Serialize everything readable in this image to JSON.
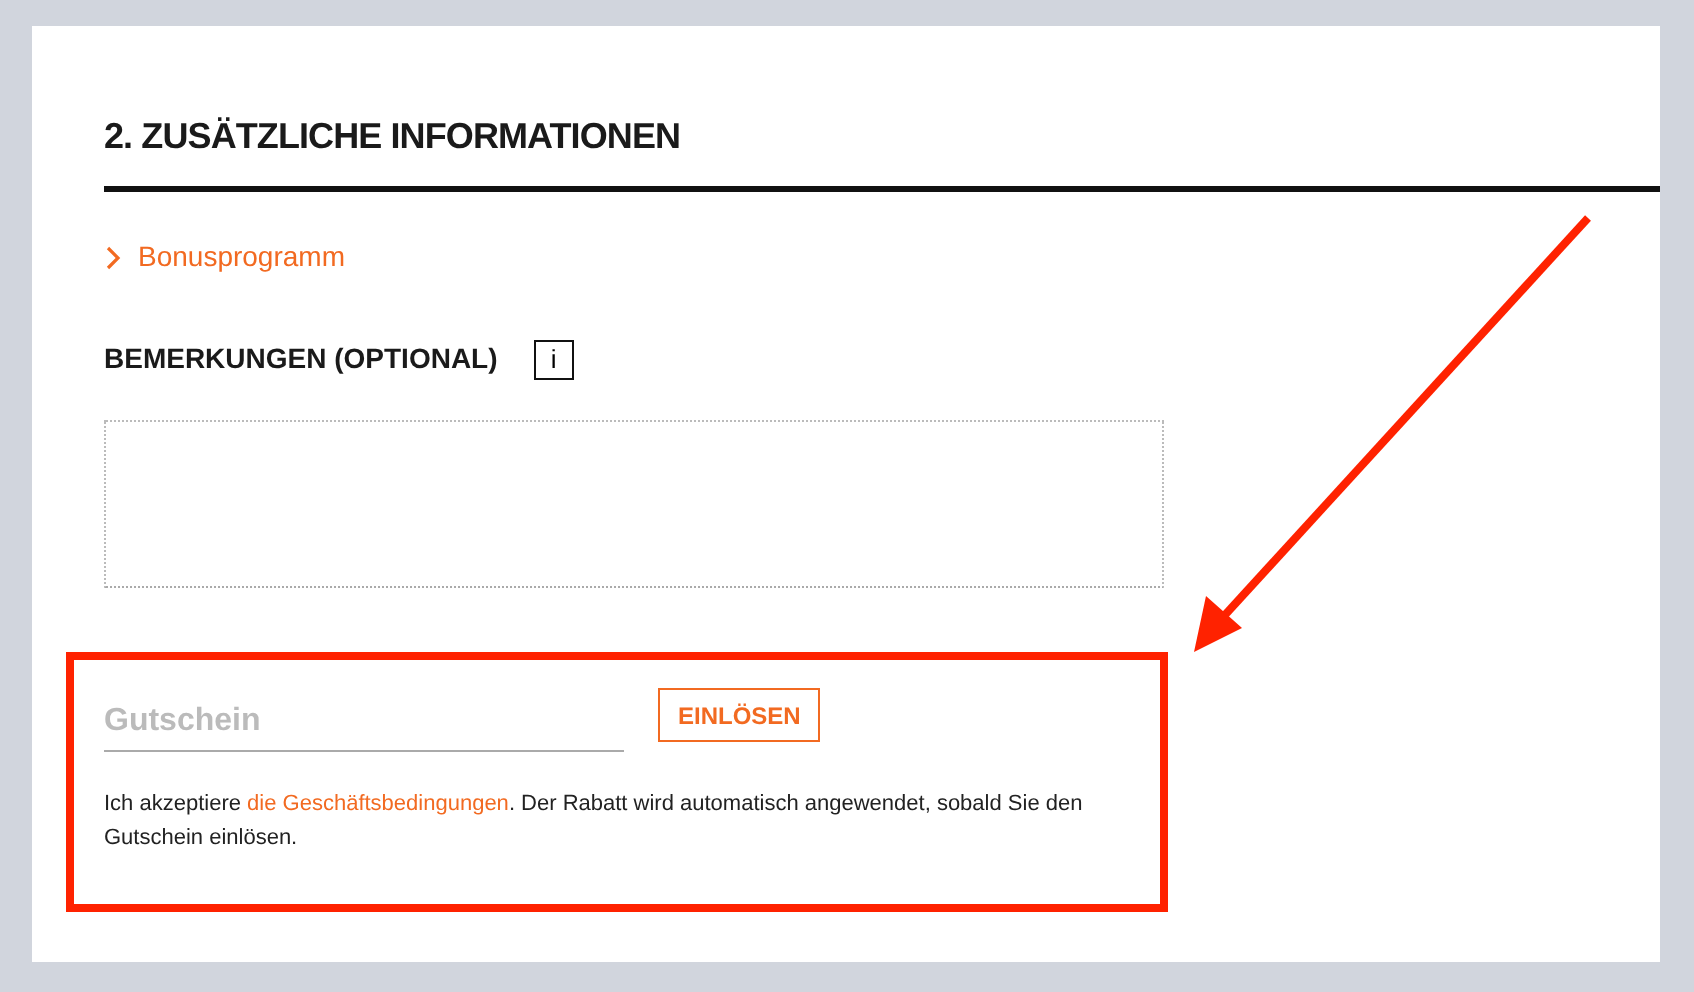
{
  "section": {
    "title": "2. ZUSÄTZLICHE INFORMATIONEN"
  },
  "bonus_link": {
    "label": "Bonusprogramm",
    "expanded": false
  },
  "remarks": {
    "label": "BEMERKUNGEN (OPTIONAL)",
    "info_icon": "i"
  },
  "voucher": {
    "placeholder": "Gutschein",
    "button": "EINLÖSEN"
  },
  "terms": {
    "before": "Ich akzeptiere ",
    "link": "die Geschäftsbedingungen",
    "after": ". Der Rabatt wird automatisch angewendet, sobald Sie den Gutschein einlösen."
  }
}
